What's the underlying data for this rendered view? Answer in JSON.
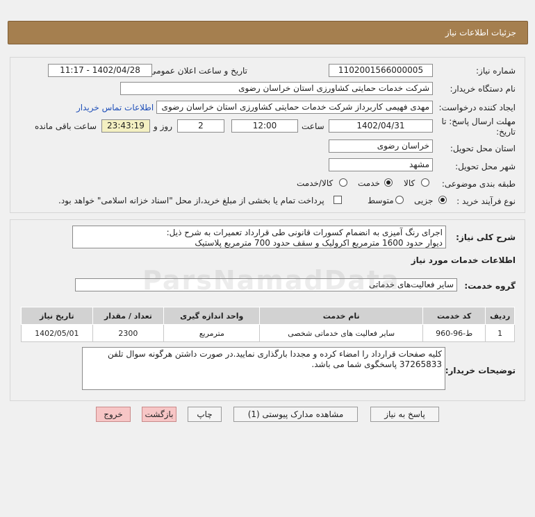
{
  "header": {
    "title": "جزئیات اطلاعات نیاز"
  },
  "info": {
    "need_number_label": "شماره نیاز:",
    "need_number": "1102001566000005",
    "announce_label": "تاریخ و ساعت اعلان عمومی:",
    "announce_value": "1402/04/28 - 11:17",
    "buyer_org_label": "نام دستگاه خریدار:",
    "buyer_org": "شرکت خدمات حمایتی کشاورزی استان خراسان رضوی",
    "creator_label": "ایجاد کننده درخواست:",
    "creator": "مهدی فهیمی کاربرداز شرکت خدمات حمایتی کشاورزی استان خراسان رضوی",
    "contact_link": "اطلاعات تماس خریدار",
    "deadline_label_1": "مهلت ارسال پاسخ: تا",
    "deadline_label_2": "تاریخ:",
    "deadline_date": "1402/04/31",
    "time_label": "ساعت",
    "deadline_time": "12:00",
    "days_value": "2",
    "days_label": "روز و",
    "remaining_time": "23:43:19",
    "remaining_label": "ساعت باقی مانده",
    "province_label": "استان محل تحویل:",
    "province": "خراسان رضوی",
    "city_label": "شهر محل تحویل:",
    "city": "مشهد",
    "category_label": "طبقه بندی موضوعی:",
    "category_options": [
      "کالا",
      "خدمت",
      "کالا/خدمت"
    ],
    "category_selected": "خدمت",
    "process_label": "نوع فرآیند خرید :",
    "process_options": [
      "جزیی",
      "متوسط"
    ],
    "process_selected": "جزیی",
    "payment_note": "پرداخت تمام یا بخشی از مبلغ خرید،از محل \"اسناد خزانه اسلامی\" خواهد بود."
  },
  "details": {
    "summary_label": "شرح کلی نیاز:",
    "summary_line1": "اجرای رنگ آمیزی به انضمام کسورات قانونی طی قرارداد تعمیرات به شرح ذیل:",
    "summary_line2": "دیوار حدود 1600 مترمربع اکرولیک و سقف حدود 700 مترمربع پلاستیک",
    "services_heading": "اطلاعات خدمات مورد نیاز",
    "group_label": "گروه خدمت:",
    "group_value": "سایر فعالیت‌های خدماتی",
    "table": {
      "headers": [
        "ردیف",
        "کد خدمت",
        "نام خدمت",
        "واحد اندازه گیری",
        "تعداد / مقدار",
        "تاریخ نیاز"
      ],
      "rows": [
        [
          "1",
          "ط-96-960",
          "سایر فعالیت های خدماتی شخصی",
          "مترمربع",
          "2300",
          "1402/05/01"
        ]
      ]
    },
    "buyer_notes_label": "توضیحات خریدار:",
    "buyer_notes_line1": "کلیه صفحات قرارداد را امضاء کرده و مجددا بارگذاری نمایید.در صورت داشتن هرگونه سوال تلفن",
    "buyer_notes_line2": "37265833 پاسخگوی شما می باشد."
  },
  "buttons": {
    "reply": "پاسخ به نیاز",
    "attachments": "مشاهده مدارک پیوستی (1)",
    "print": "چاپ",
    "back": "بازگشت",
    "exit": "خروج"
  },
  "watermark": {
    "text": "ParsNamadData"
  }
}
